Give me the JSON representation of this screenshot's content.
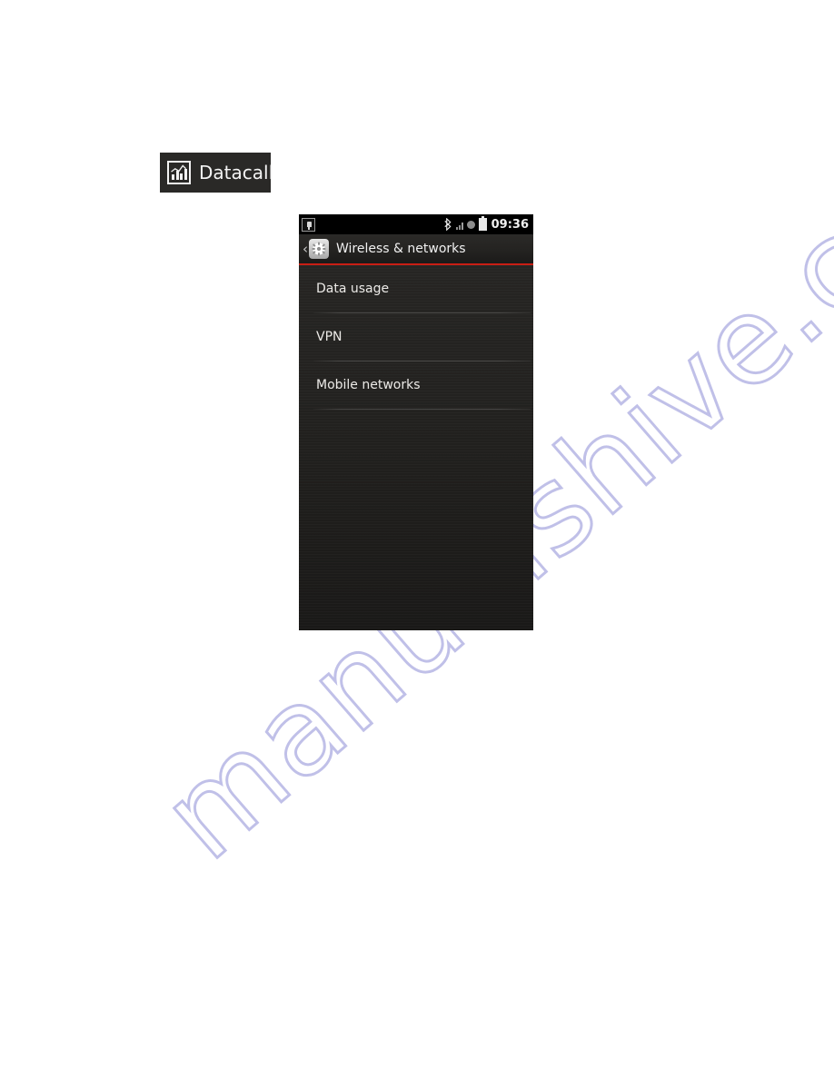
{
  "caption": {
    "label": "Datacall",
    "icon": "datacall-chart-icon"
  },
  "phone": {
    "status_bar": {
      "left_icons": [
        "usb-plug-icon"
      ],
      "right_icons": [
        "bluetooth-icon",
        "signal-bars-icon",
        "circle-indicator-icon",
        "battery-icon"
      ],
      "clock": "09:36"
    },
    "title_bar": {
      "back_icon": "‹",
      "app_icon": "settings-gear-icon",
      "title": "Wireless & networks",
      "accent_color": "#c81e14"
    },
    "list_items": [
      {
        "label": "Data usage"
      },
      {
        "label": "VPN"
      },
      {
        "label": "Mobile networks"
      }
    ]
  },
  "watermark": {
    "text": "manualshive.com",
    "color": "#c0c0e8"
  }
}
